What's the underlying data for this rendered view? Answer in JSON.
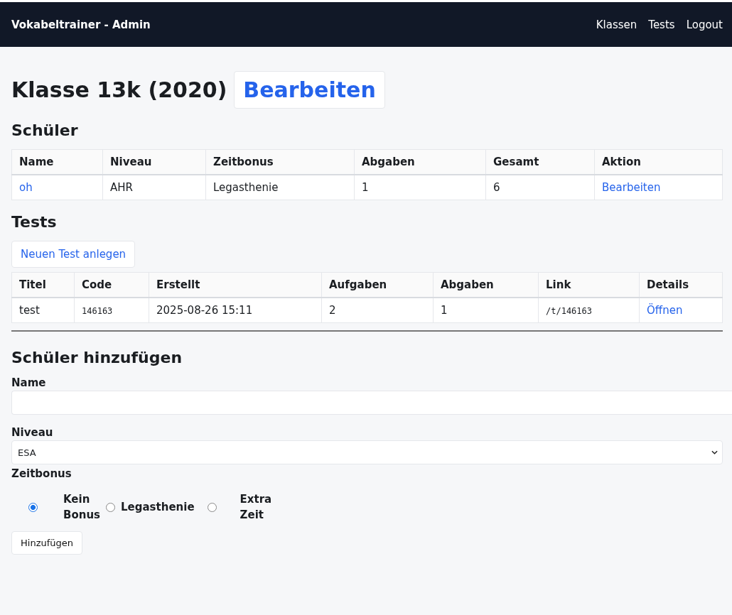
{
  "navbar": {
    "brand": "Vokabeltrainer - Admin",
    "links": [
      "Klassen",
      "Tests",
      "Logout"
    ]
  },
  "page_title": "Klasse 13k (2020)",
  "edit_button": "Bearbeiten",
  "students": {
    "heading": "Schüler",
    "columns": [
      "Name",
      "Niveau",
      "Zeitbonus",
      "Abgaben",
      "Gesamt",
      "Aktion"
    ],
    "rows": [
      [
        {
          "text": "oh",
          "kind": "link"
        },
        {
          "text": "AHR",
          "kind": "text"
        },
        {
          "text": "Legasthenie",
          "kind": "text"
        },
        {
          "text": "1",
          "kind": "text"
        },
        {
          "text": "6",
          "kind": "text"
        },
        {
          "text": "Bearbeiten",
          "kind": "link"
        }
      ]
    ]
  },
  "tests": {
    "heading": "Tests",
    "new_button": "Neuen Test anlegen",
    "columns": [
      "Titel",
      "Code",
      "Erstellt",
      "Aufgaben",
      "Abgaben",
      "Link",
      "Details"
    ],
    "rows": [
      [
        {
          "text": "test",
          "kind": "text"
        },
        {
          "text": "146163",
          "kind": "code"
        },
        {
          "text": "2025-08-26 15:11",
          "kind": "text"
        },
        {
          "text": "2",
          "kind": "text"
        },
        {
          "text": "1",
          "kind": "text"
        },
        {
          "text": "/t/146163",
          "kind": "code"
        },
        {
          "text": "Öffnen",
          "kind": "link"
        }
      ]
    ]
  },
  "add_form": {
    "heading": "Schüler hinzufügen",
    "name_label": "Name",
    "level_label": "Niveau",
    "level_value": "ESA",
    "bonus_label": "Zeitbonus",
    "bonus_options": [
      {
        "label": "Kein Bonus",
        "selected": true
      },
      {
        "label": "Legasthenie",
        "selected": false
      },
      {
        "label": "Extra Zeit",
        "selected": false
      }
    ],
    "submit": "Hinzufügen"
  }
}
